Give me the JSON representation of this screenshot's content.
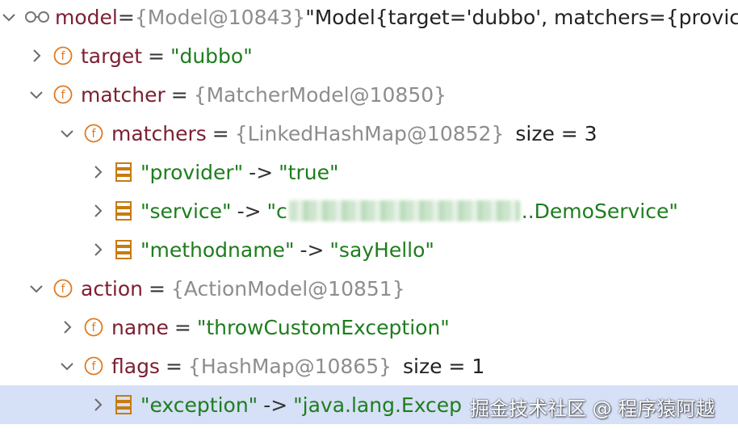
{
  "colors": {
    "name": "#7c2032",
    "string": "#1e7d1e",
    "reference": "#8d8d8d",
    "field_icon": "#e07a22",
    "entry_icon": "#c77b12",
    "selected_row": "#d6e0f7"
  },
  "tree": {
    "model": {
      "icon": "watch-glasses-icon",
      "name": "model",
      "eq": "=",
      "ref": "{Model@10843}",
      "value": "\"Model{target='dubbo', matchers={provic"
    },
    "target": {
      "icon": "field-icon",
      "name": "target",
      "eq": "=",
      "value": "\"dubbo\""
    },
    "matcher": {
      "icon": "field-icon",
      "name": "matcher",
      "eq": "=",
      "ref": "{MatcherModel@10850}"
    },
    "matchers": {
      "icon": "field-icon",
      "name": "matchers",
      "eq": "=",
      "ref": "{LinkedHashMap@10852}",
      "size": "size = 3"
    },
    "entries": [
      {
        "icon": "map-entry-icon",
        "key": "\"provider\"",
        "arrow": "->",
        "value": "\"true\""
      },
      {
        "icon": "map-entry-icon",
        "key": "\"service\"",
        "arrow": "->",
        "value_start": "\"c",
        "value_end": "..DemoService\""
      },
      {
        "icon": "map-entry-icon",
        "key": "\"methodname\"",
        "arrow": "->",
        "value": "\"sayHello\""
      }
    ],
    "action": {
      "icon": "field-icon",
      "name": "action",
      "eq": "=",
      "ref": "{ActionModel@10851}"
    },
    "action_name": {
      "icon": "field-icon",
      "name": "name",
      "eq": "=",
      "value": "\"throwCustomException\""
    },
    "flags": {
      "icon": "field-icon",
      "name": "flags",
      "eq": "=",
      "ref": "{HashMap@10865}",
      "size": "size = 1"
    },
    "exception": {
      "icon": "map-entry-icon",
      "key": "\"exception\"",
      "arrow": "->",
      "value": "\"java.lang.Excep",
      "selected": true
    }
  },
  "watermark": "掘金技术社区 @ 程序猿阿越"
}
